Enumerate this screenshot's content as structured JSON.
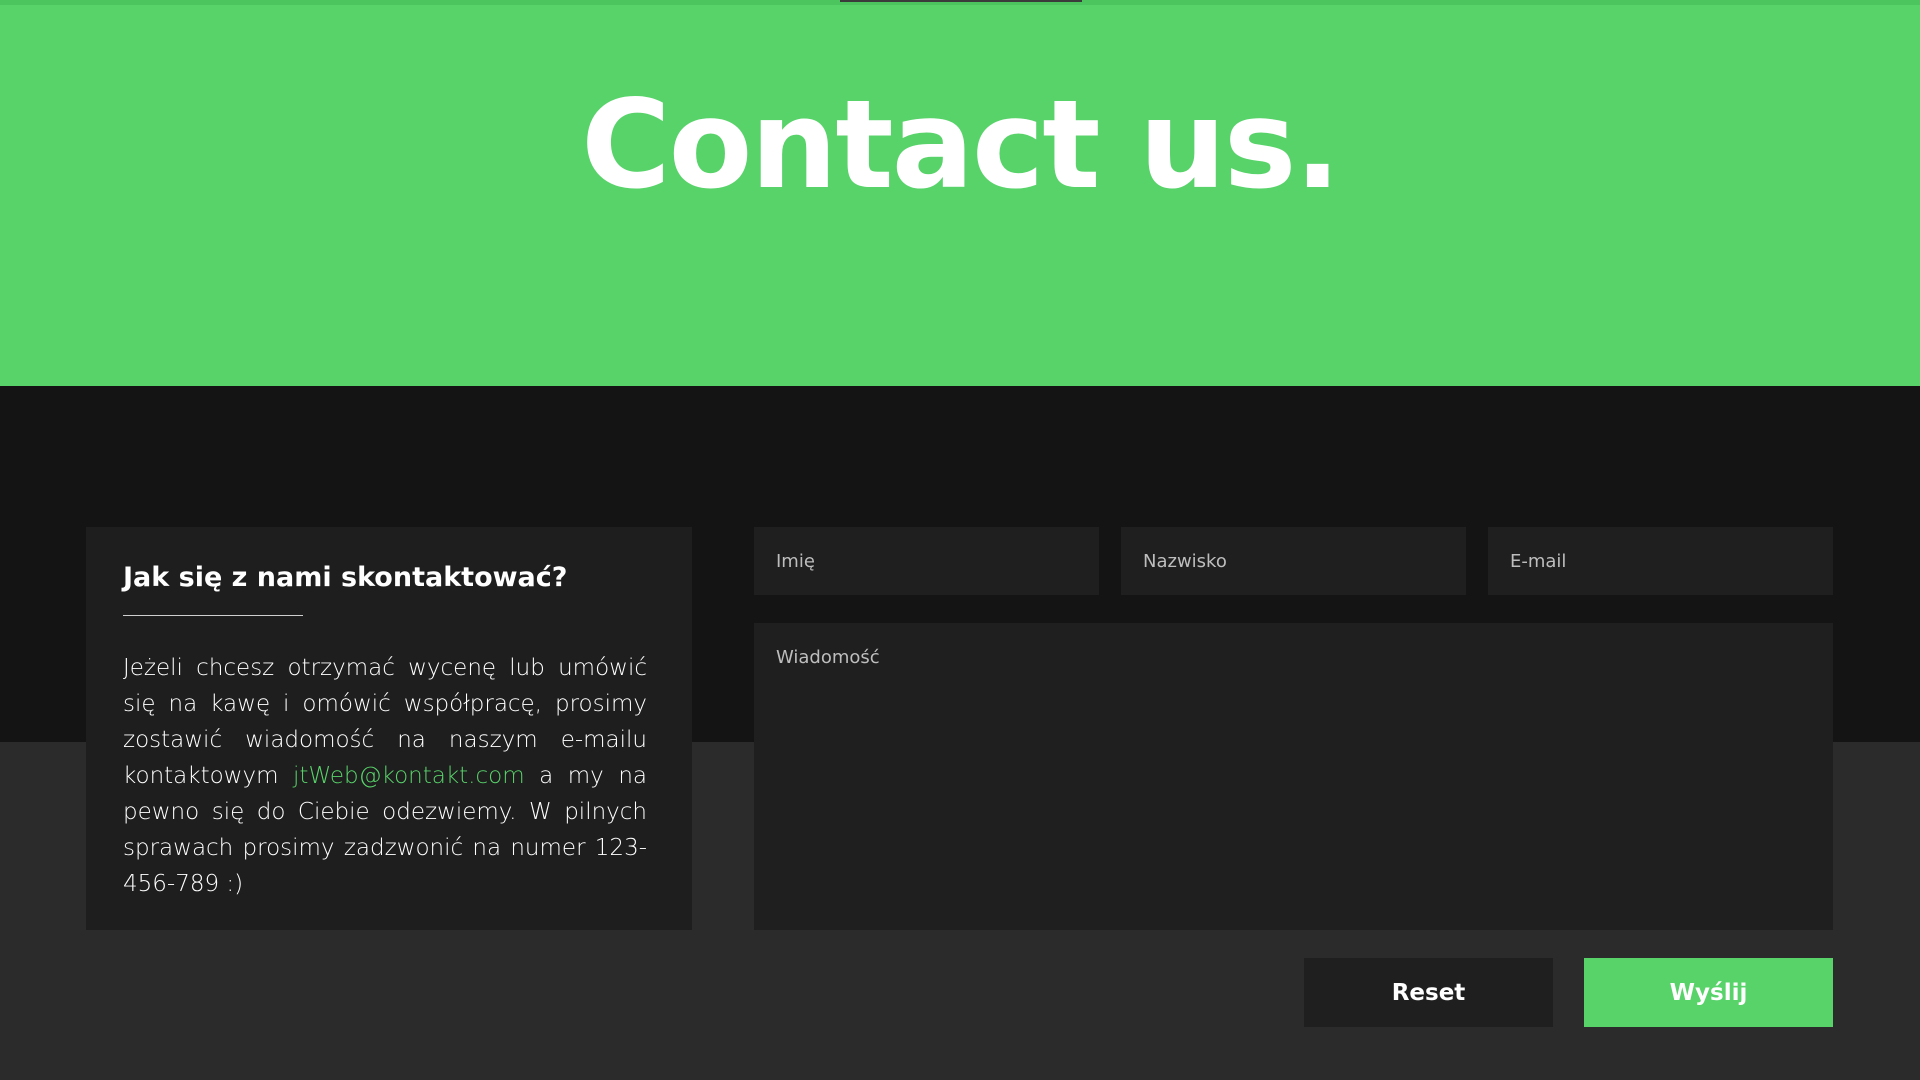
{
  "hero": {
    "title": "Contact us."
  },
  "info": {
    "heading": "Jak się z nami skontaktować?",
    "text_before_email": "Jeżeli chcesz otrzymać wycenę lub umówić się na kawę i omówić współpracę, prosimy zostawić wiadomość na naszym e-mailu kontaktowym ",
    "email": "jtWeb@kontakt.com",
    "text_after_email": " a my na pewno się do Ciebie odezwiemy. W pilnych sprawach prosimy zadzwonić na numer 123-456-789 :)"
  },
  "form": {
    "first_name_placeholder": "Imię",
    "last_name_placeholder": "Nazwisko",
    "email_placeholder": "E-mail",
    "message_placeholder": "Wiadomość",
    "reset_label": "Reset",
    "send_label": "Wyślij"
  },
  "colors": {
    "accent": "#58d36a",
    "dark_band": "#141414",
    "background": "#2b2b2b",
    "card": "#1e1e1e"
  }
}
